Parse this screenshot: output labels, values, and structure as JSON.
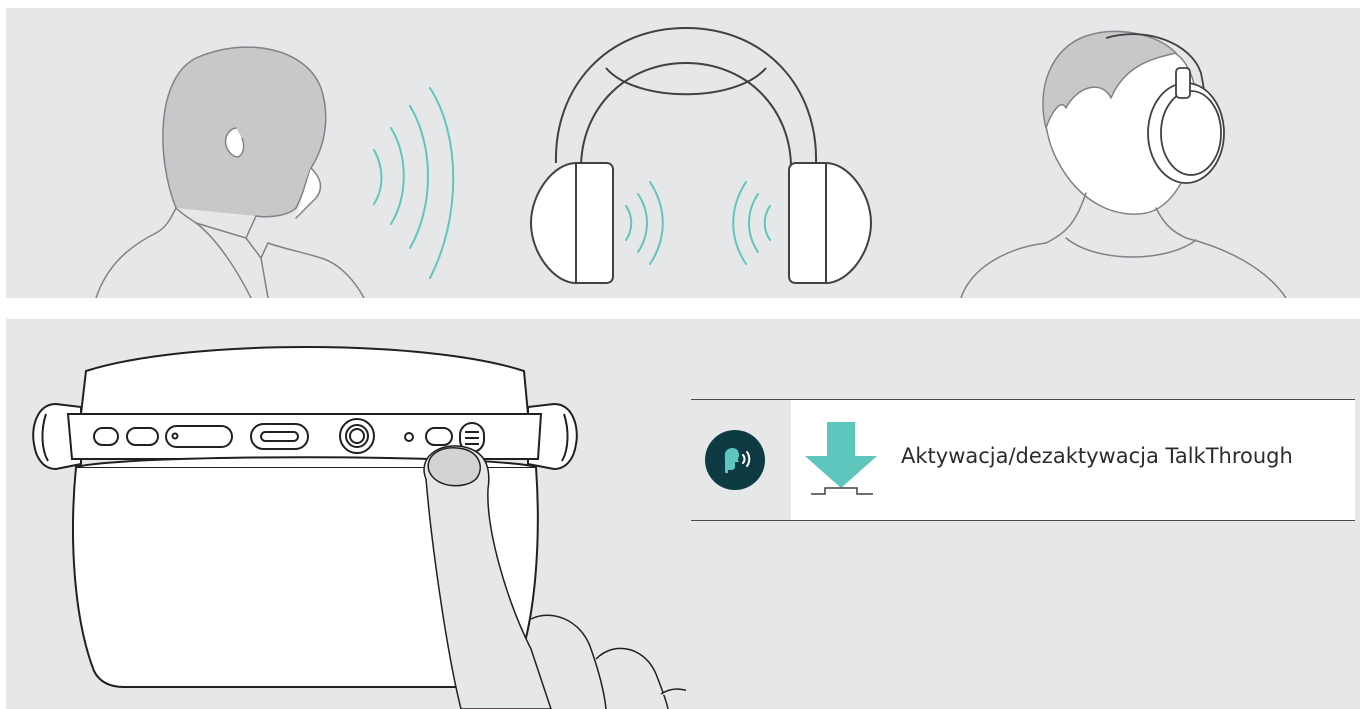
{
  "legend": {
    "action_label": "Aktywacja/dezaktywacja TalkThrough",
    "talk_icon": "talkthrough-icon",
    "press_icon": "press-down-arrow-icon"
  },
  "colors": {
    "panel_bg": "#e6e7e8",
    "sound_wave": "#5fc6bd",
    "icon_dark": "#0e3b43",
    "arrow": "#5fc6bd",
    "line": "#4a4a4a"
  }
}
